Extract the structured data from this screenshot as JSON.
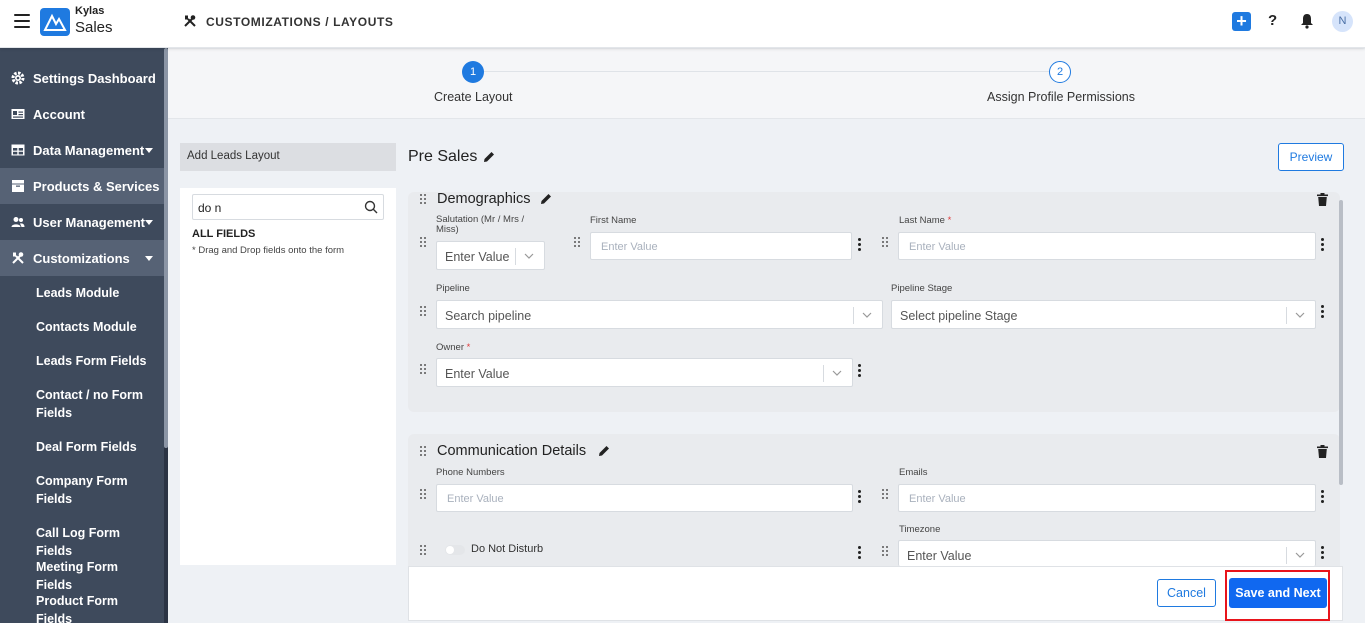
{
  "header": {
    "brand_top": "Kylas",
    "brand_bottom": "Sales",
    "breadcrumb": "CUSTOMIZATIONS / LAYOUTS",
    "plus_label": "+",
    "help_label": "?",
    "avatar_initial": "N"
  },
  "sidebar": {
    "items": [
      {
        "label": "Settings Dashboard",
        "icon": "gear-icon"
      },
      {
        "label": "Account",
        "icon": "id-card-icon"
      },
      {
        "label": "Data Management",
        "icon": "table-icon"
      },
      {
        "label": "Products & Services",
        "icon": "box-icon"
      },
      {
        "label": "User Management",
        "icon": "users-icon"
      },
      {
        "label": "Customizations",
        "icon": "tools-icon"
      }
    ],
    "sub_items": [
      "Leads Module",
      "Contacts Module",
      "Leads Form Fields",
      "Contact / no Form Fields",
      "Deal Form Fields",
      "Company Form Fields",
      "Call Log Form Fields",
      "Meeting Form Fields",
      "Product Form Fields"
    ]
  },
  "stepper": {
    "step1_number": "1",
    "step1_label": "Create Layout",
    "step2_number": "2",
    "step2_label": "Assign Profile Permissions"
  },
  "field_panel": {
    "tab_label": "Add Leads Layout",
    "search_value": "do n",
    "all_fields_label": "ALL FIELDS",
    "hint": "* Drag and Drop fields onto the form"
  },
  "layout": {
    "title": "Pre Sales",
    "preview_label": "Preview"
  },
  "sections": {
    "demographics": {
      "title": "Demographics",
      "salutation_label": "Salutation (Mr / Mrs / Miss)",
      "salutation_value": "Enter Value",
      "first_name_label": "First Name",
      "first_name_placeholder": "Enter Value",
      "last_name_label": "Last Name",
      "last_name_placeholder": "Enter Value",
      "pipeline_label": "Pipeline",
      "pipeline_value": "Search pipeline",
      "pipeline_stage_label": "Pipeline Stage",
      "pipeline_stage_value": "Select pipeline Stage",
      "owner_label": "Owner",
      "owner_value": "Enter Value",
      "required_mark": "*"
    },
    "communication": {
      "title": "Communication Details",
      "phone_label": "Phone Numbers",
      "phone_placeholder": "Enter Value",
      "emails_label": "Emails",
      "emails_placeholder": "Enter Value",
      "dnd_label": "Do Not Disturb",
      "dnd_on": false,
      "timezone_label": "Timezone",
      "timezone_value": "Enter Value"
    }
  },
  "footer": {
    "cancel_label": "Cancel",
    "save_label": "Save and Next"
  },
  "colors": {
    "accent": "#1f7ae0",
    "sidebar_bg": "#3e4a5c",
    "highlight": "#e8141b"
  }
}
